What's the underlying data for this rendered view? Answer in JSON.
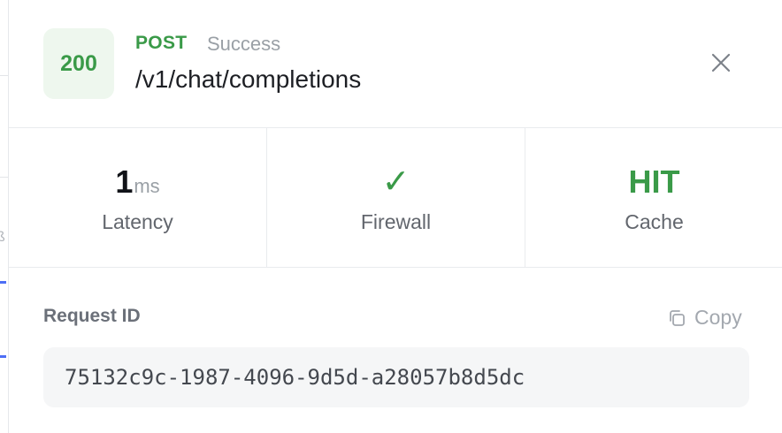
{
  "request": {
    "status_code": "200",
    "method": "POST",
    "status_text": "Success",
    "endpoint": "/v1/chat/completions"
  },
  "stats": {
    "latency": {
      "value": "1",
      "unit": "ms",
      "label": "Latency"
    },
    "firewall": {
      "value": "✓",
      "label": "Firewall"
    },
    "cache": {
      "value": "HIT",
      "label": "Cache"
    }
  },
  "request_id": {
    "label": "Request ID",
    "copy_label": "Copy",
    "value": "75132c9c-1987-4096-9d5d-a28057b8d5dc"
  },
  "colors": {
    "success": "#3a9a48",
    "success_bg": "#eef7ee",
    "muted": "#9aa0a6"
  },
  "icons": [
    "close-icon",
    "copy-icon",
    "check-icon"
  ]
}
